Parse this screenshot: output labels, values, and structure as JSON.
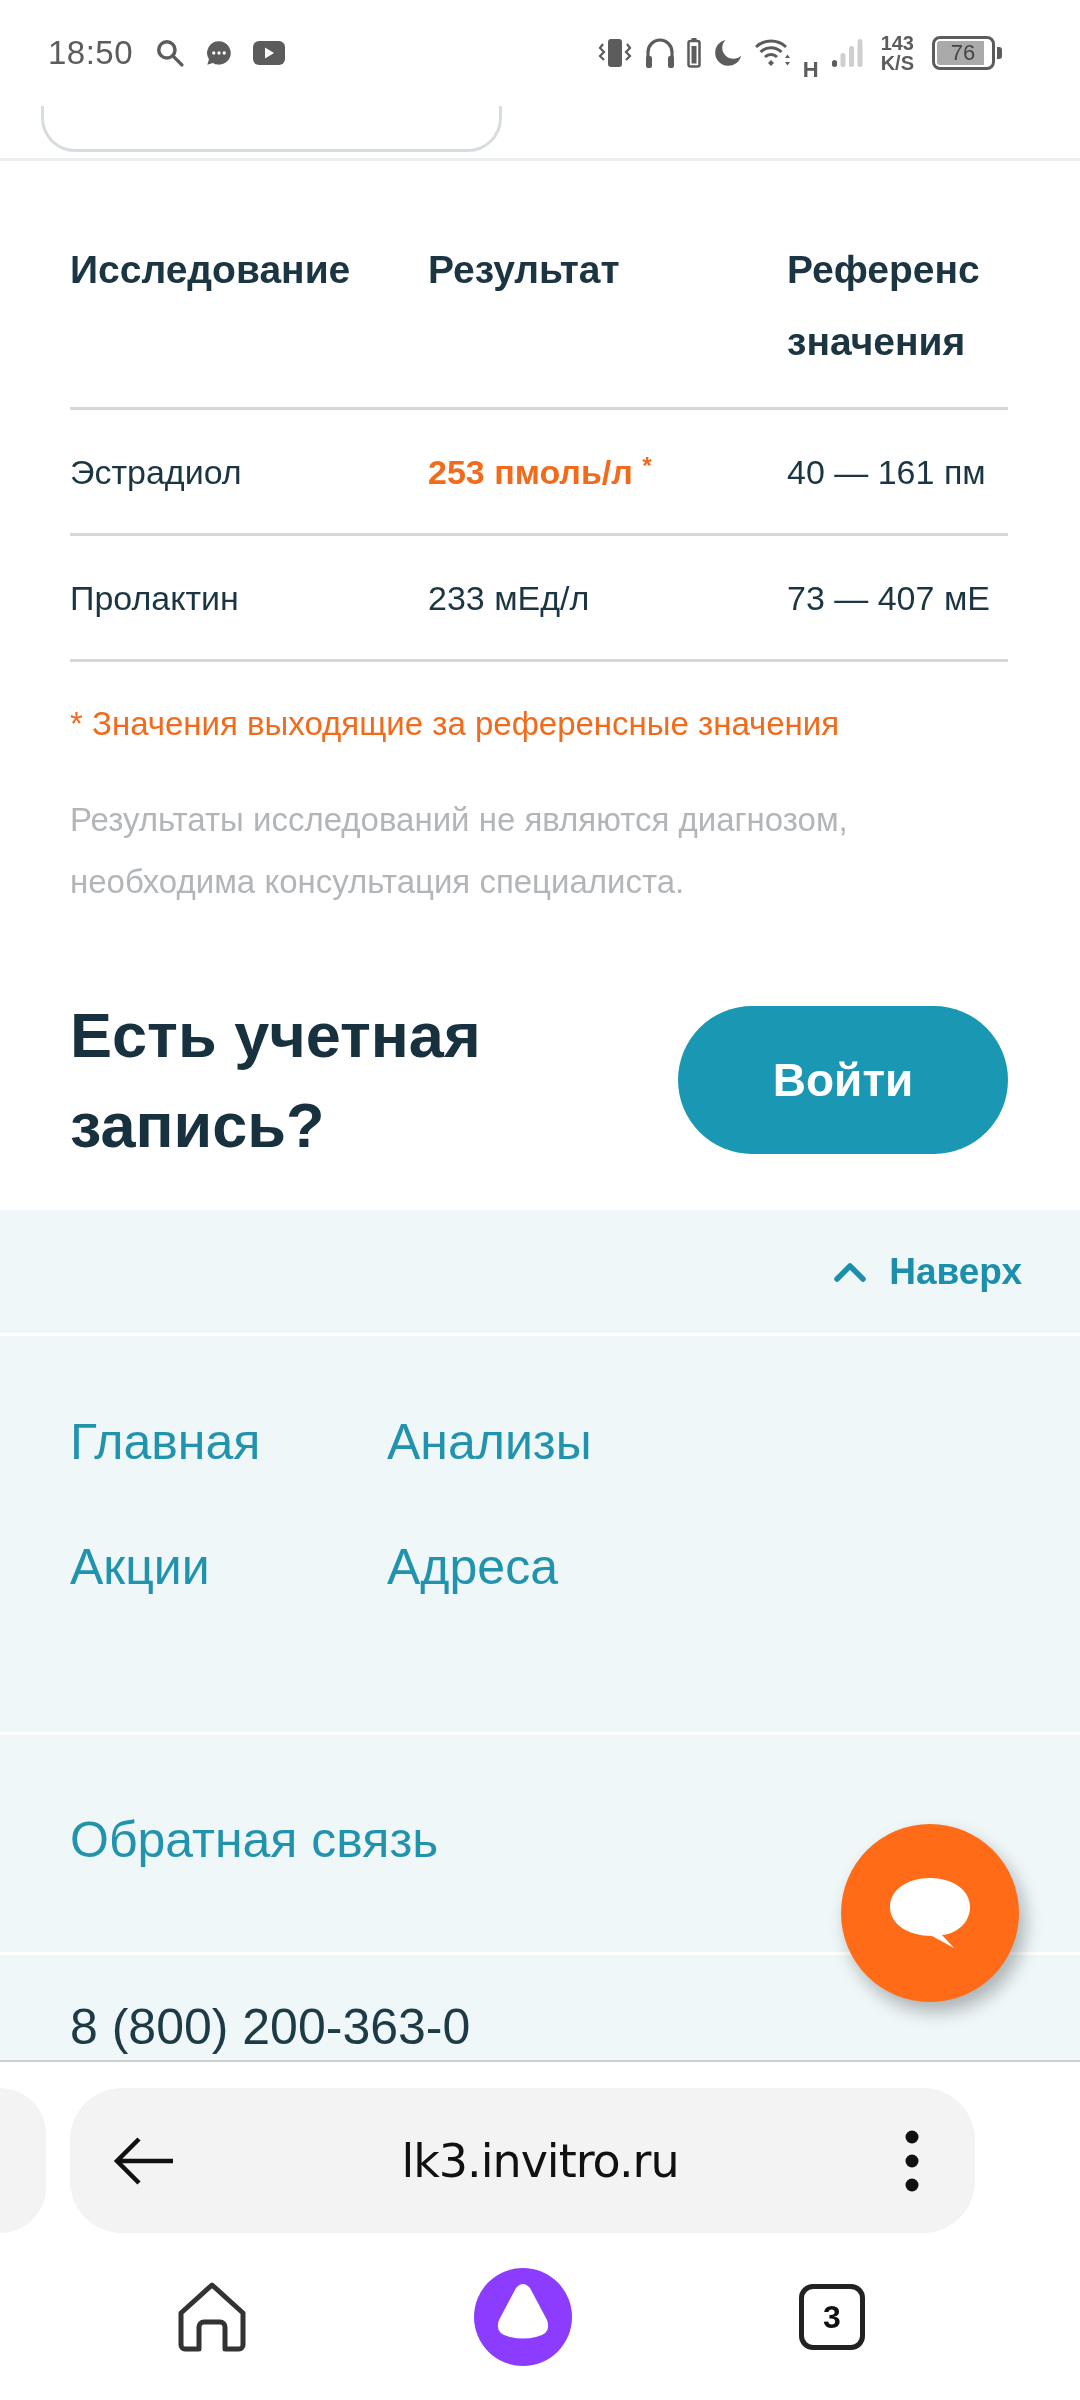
{
  "status_bar": {
    "time": "18:50",
    "network_type": "H",
    "data_speed": "143",
    "data_speed_unit": "K/S",
    "battery": "76"
  },
  "results_table": {
    "columns": [
      "Исследование",
      "Результат",
      "Референс значения"
    ],
    "rows": [
      {
        "study": "Эстрадиол",
        "result": "253 пмоль/л $^{*}$",
        "out_of_range": true,
        "reference": "40 — 161 пм"
      },
      {
        "study": "Пролактин",
        "result": "233 мЕд/л",
        "out_of_range": false,
        "reference": "73 — 407 мЕ"
      }
    ]
  },
  "footnote": "* Значения выходящие за референсные значения",
  "disclaimer": "Результаты исследований не являются диагнозом, необходима консультация специалиста.",
  "login_prompt": {
    "title": "Есть учетная запись?",
    "button": "Войти"
  },
  "footer": {
    "back_to_top": "Наверх",
    "nav_links": [
      "Главная",
      "Анализы",
      "Акции",
      "Адреса"
    ],
    "feedback_link": "Обратная связь",
    "phone": "8 (800) 200-363-0"
  },
  "browser": {
    "url": "lk3.invitro.ru",
    "tab_count": "3"
  }
}
